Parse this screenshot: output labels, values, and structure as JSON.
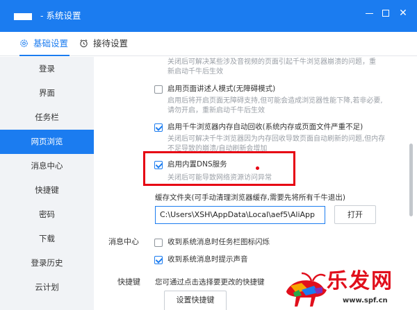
{
  "window": {
    "title": "- 系统设置",
    "min_icon": "minimize-icon",
    "max_icon": "maximize-icon",
    "close_icon": "close-icon",
    "close_glyph": "✕"
  },
  "tabs": [
    {
      "label": "基础设置",
      "icon": "gear-icon",
      "active": true
    },
    {
      "label": "接待设置",
      "icon": "alarm-clock-icon",
      "active": false
    }
  ],
  "sidebar": {
    "items": [
      {
        "label": "登录"
      },
      {
        "label": "界面"
      },
      {
        "label": "任务栏"
      },
      {
        "label": "网页浏览",
        "active": true
      },
      {
        "label": "消息中心"
      },
      {
        "label": "快捷键"
      },
      {
        "label": "密码"
      },
      {
        "label": "下载"
      },
      {
        "label": "登录历史"
      },
      {
        "label": "云计划"
      }
    ]
  },
  "content": {
    "desc_top_1": "关闭后可解决某些涉及音视频的页面引起千牛浏览器崩溃的问题，重",
    "desc_top_2": "新启动千牛后生效",
    "opt_narrator": {
      "label": "启用页面讲述人模式(无障碍模式)",
      "checked": false
    },
    "desc_narrator_1": "启用后将开启页面无障碍支持,但可能会造成浏览器性能下降,若非必要,",
    "desc_narrator_2": "请勿开启，重新启动千牛后生效",
    "opt_memory": {
      "label": "启用千牛浏览器内存自动回收(系统内存或页面文件严重不足)",
      "checked": true
    },
    "desc_memory_1": "关闭后可解决千牛浏览器因为内存回收导致页面自动刷新的问题,但内存",
    "desc_memory_2": "不足导致的崩溃/自动刷新会增加",
    "opt_dns": {
      "label": "启用内置DNS服务",
      "checked": true
    },
    "desc_dns": "关闭后可能导致网络资源访问异常",
    "cache_label": "缓存文件夹(可手动清理浏览器缓存,需要先将所有千牛退出)",
    "cache_path": "C:\\Users\\XSH\\AppData\\Local\\aef5\\AliApp",
    "open_button": "打开",
    "msg_section": "消息中心",
    "opt_flash": {
      "label": "收到系统消息时任务栏图标闪烁",
      "checked": false
    },
    "opt_sound": {
      "label": "收到系统消息时提示声音",
      "checked": true
    },
    "shortcut_section": "快捷键",
    "shortcut_desc": "您可通过点击选择要更改的快捷键",
    "shortcut_button": "设置快捷键"
  },
  "watermark": {
    "text": "乐发网",
    "url": "www.spf.cn"
  },
  "colors": {
    "accent": "#1b7cf0",
    "highlight": "#e60012"
  }
}
